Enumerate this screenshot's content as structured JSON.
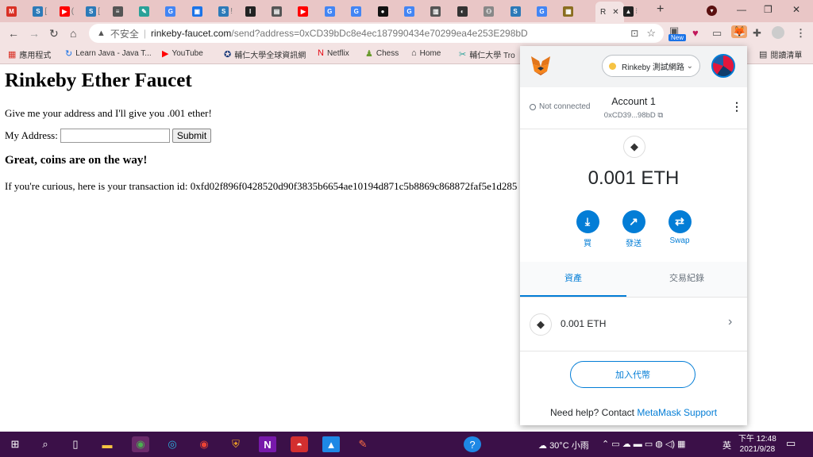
{
  "tabs": [
    {
      "letter": "M",
      "color": "#d93025",
      "label": ""
    },
    {
      "letter": "S",
      "color": "#2c7ab8",
      "label": "["
    },
    {
      "letter": "▶",
      "color": "#ff0000",
      "label": "("
    },
    {
      "letter": "S",
      "color": "#2c7ab8",
      "label": "["
    },
    {
      "letter": "≡",
      "color": "#555555",
      "label": ""
    },
    {
      "letter": "✎",
      "color": "#2aa198",
      "label": ""
    },
    {
      "letter": "G",
      "color": "#4285f4",
      "label": ""
    },
    {
      "letter": "▣",
      "color": "#1a73e8",
      "label": ""
    },
    {
      "letter": "S",
      "color": "#2c7ab8",
      "label": "!"
    },
    {
      "letter": "I",
      "color": "#222222",
      "label": ""
    },
    {
      "letter": "▤",
      "color": "#555555",
      "label": ""
    },
    {
      "letter": "▶",
      "color": "#ff0000",
      "label": ""
    },
    {
      "letter": "G",
      "color": "#4285f4",
      "label": ""
    },
    {
      "letter": "G",
      "color": "#4285f4",
      "label": ""
    },
    {
      "letter": "●",
      "color": "#111111",
      "label": ""
    },
    {
      "letter": "G",
      "color": "#4285f4",
      "label": ""
    },
    {
      "letter": "▥",
      "color": "#555555",
      "label": ""
    },
    {
      "letter": "◐",
      "color": "#333333",
      "label": ""
    },
    {
      "letter": "⚇",
      "color": "#888888",
      "label": ""
    },
    {
      "letter": "S",
      "color": "#2c7ab8",
      "label": ""
    },
    {
      "letter": "G",
      "color": "#4285f4",
      "label": ""
    },
    {
      "letter": "▦",
      "color": "#8a6d1f",
      "label": ""
    }
  ],
  "active_tab": {
    "label": "R"
  },
  "omnibox": {
    "insecure_label": "不安全",
    "host": "rinkeby-faucet.com",
    "path": "/send?address=0xCD39bDc8e4ec187990434e70299ea4e253E298bD",
    "new_badge": "New"
  },
  "bookmarks": [
    {
      "label": "應用程式",
      "icon": "▦",
      "color": "#d93025"
    },
    {
      "label": "Learn Java - Java T...",
      "icon": "↻",
      "color": "#1a73e8"
    },
    {
      "label": "YouTube",
      "icon": "▶",
      "color": "#ff0000"
    },
    {
      "label": "輔仁大學全球資訊網",
      "icon": "✪",
      "color": "#1a3a7a"
    },
    {
      "label": "Netflix",
      "icon": "N",
      "color": "#e50914"
    },
    {
      "label": "Chess",
      "icon": "♟",
      "color": "#6a9b2f"
    },
    {
      "label": "Home",
      "icon": "⌂",
      "color": "#333333"
    },
    {
      "label": "輔仁大學 Tro",
      "icon": "✂",
      "color": "#2aa198"
    }
  ],
  "reading_list": "閱讀清單",
  "page": {
    "title": "Rinkeby Ether Faucet",
    "intro": "Give me your address and I'll give you .001 ether!",
    "address_label": "My Address:",
    "address_value": "",
    "submit_label": "Submit",
    "success_heading": "Great, coins are on the way!",
    "tx_text": "If you're curious, here is your transaction id: 0xfd02f896f0428520d90f3835b6654ae10194d871c5b8869c868872faf5e1d285"
  },
  "metamask": {
    "network": "Rinkeby 測試網路",
    "connection_status": "Not connected",
    "account_name": "Account 1",
    "account_address": "0xCD39...98bD",
    "balance": "0.001 ETH",
    "actions": [
      {
        "label": "買",
        "icon": "⤓"
      },
      {
        "label": "發送",
        "icon": "↗"
      },
      {
        "label": "Swap",
        "icon": "⇄"
      }
    ],
    "tabs": [
      "資產",
      "交易紀錄"
    ],
    "asset_value": "0.001 ETH",
    "add_token": "加入代幣",
    "help_prefix": "Need help? Contact ",
    "help_link": "MetaMask Support"
  },
  "taskbar": {
    "weather": "30°C 小雨",
    "ime": "英",
    "time": "下午 12:48",
    "date": "2021/9/28"
  }
}
